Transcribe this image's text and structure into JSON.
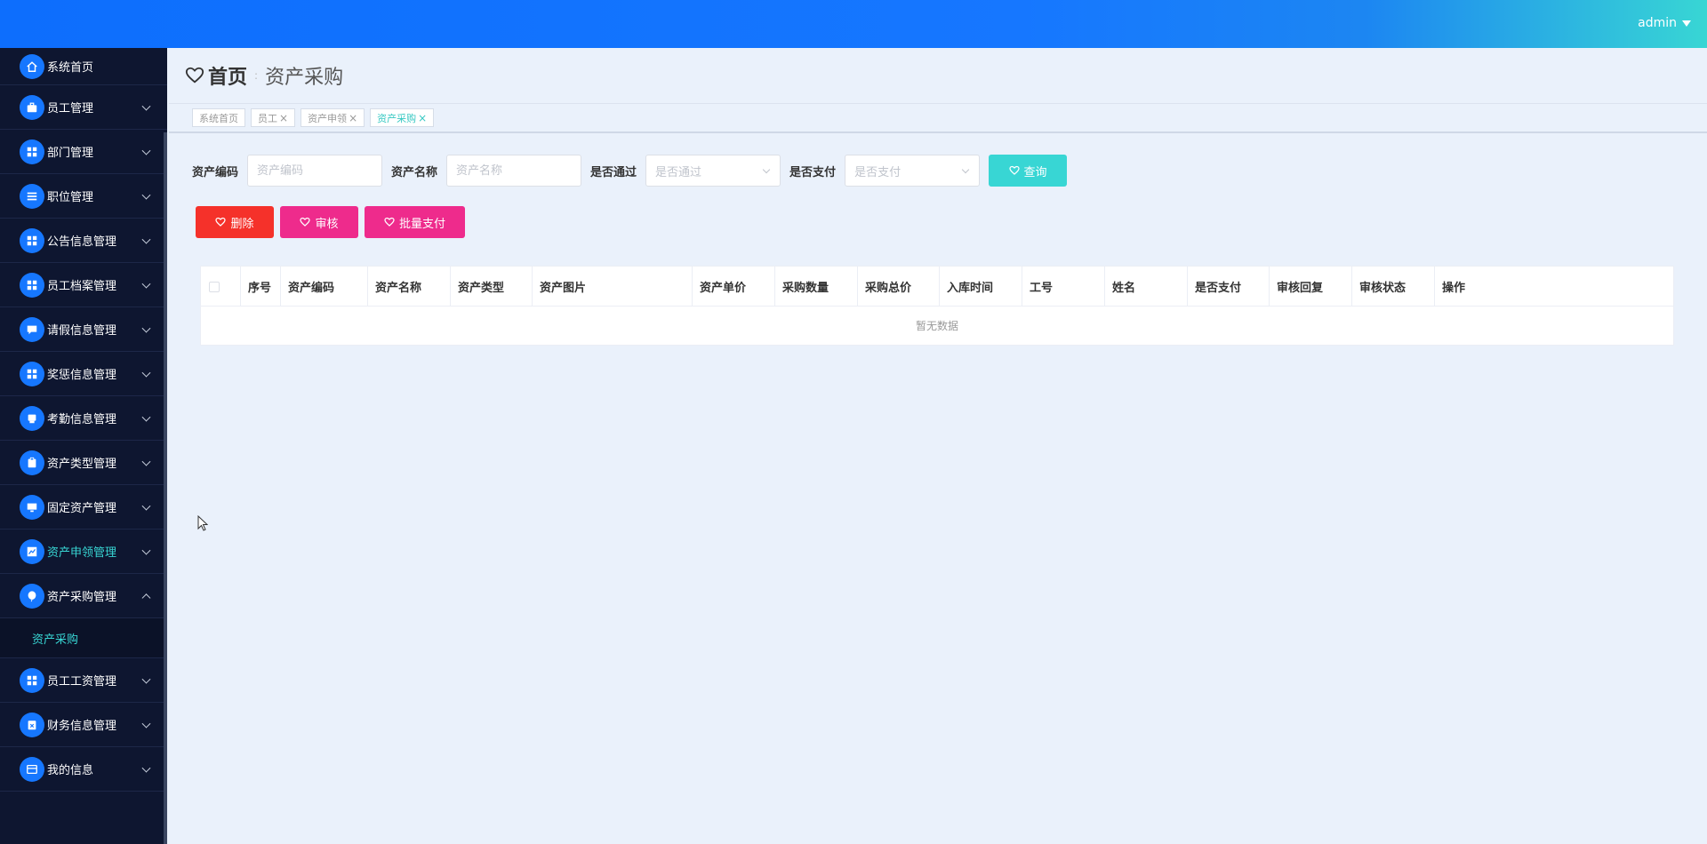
{
  "header": {
    "user": "admin"
  },
  "sidebar": {
    "items": [
      {
        "label": "系统首页",
        "icon": "home-icon"
      },
      {
        "label": "员工管理",
        "icon": "briefcase-icon"
      },
      {
        "label": "部门管理",
        "icon": "grid-icon"
      },
      {
        "label": "职位管理",
        "icon": "list-icon"
      },
      {
        "label": "公告信息管理",
        "icon": "grid-icon"
      },
      {
        "label": "员工档案管理",
        "icon": "grid-icon"
      },
      {
        "label": "请假信息管理",
        "icon": "chat-icon"
      },
      {
        "label": "奖惩信息管理",
        "icon": "grid-icon"
      },
      {
        "label": "考勤信息管理",
        "icon": "printer-icon"
      },
      {
        "label": "资产类型管理",
        "icon": "clipboard-icon"
      },
      {
        "label": "固定资产管理",
        "icon": "monitor-icon"
      },
      {
        "label": "资产申领管理",
        "icon": "chart-icon"
      },
      {
        "label": "资产采购管理",
        "icon": "balloon-icon"
      },
      {
        "label": "员工工资管理",
        "icon": "grid-icon"
      },
      {
        "label": "财务信息管理",
        "icon": "clipboard-x-icon"
      },
      {
        "label": "我的信息",
        "icon": "card-icon"
      }
    ],
    "sub_items": [
      {
        "label": "资产采购"
      }
    ]
  },
  "page": {
    "home": "首页",
    "separator": ":",
    "current": "资产采购"
  },
  "tabs": [
    {
      "label": "系统首页",
      "closable": false
    },
    {
      "label": "员工",
      "closable": true
    },
    {
      "label": "资产申领",
      "closable": true
    },
    {
      "label": "资产采购",
      "closable": true,
      "active": true
    }
  ],
  "search": {
    "code_label": "资产编码",
    "code_placeholder": "资产编码",
    "name_label": "资产名称",
    "name_placeholder": "资产名称",
    "passed_label": "是否通过",
    "passed_placeholder": "是否通过",
    "paid_label": "是否支付",
    "paid_placeholder": "是否支付",
    "query_button": "查询"
  },
  "actions": {
    "delete": "删除",
    "audit": "审核",
    "batch_pay": "批量支付"
  },
  "table": {
    "columns": [
      "序号",
      "资产编码",
      "资产名称",
      "资产类型",
      "资产图片",
      "资产单价",
      "采购数量",
      "采购总价",
      "入库时间",
      "工号",
      "姓名",
      "是否支付",
      "审核回复",
      "审核状态",
      "操作"
    ],
    "empty_text": "暂无数据"
  },
  "colors": {
    "accent": "#1677ff",
    "teal": "#38d6d4",
    "danger": "#f5312a",
    "pink": "#ee2b8c",
    "sidebar_bg": "#0e1630"
  }
}
